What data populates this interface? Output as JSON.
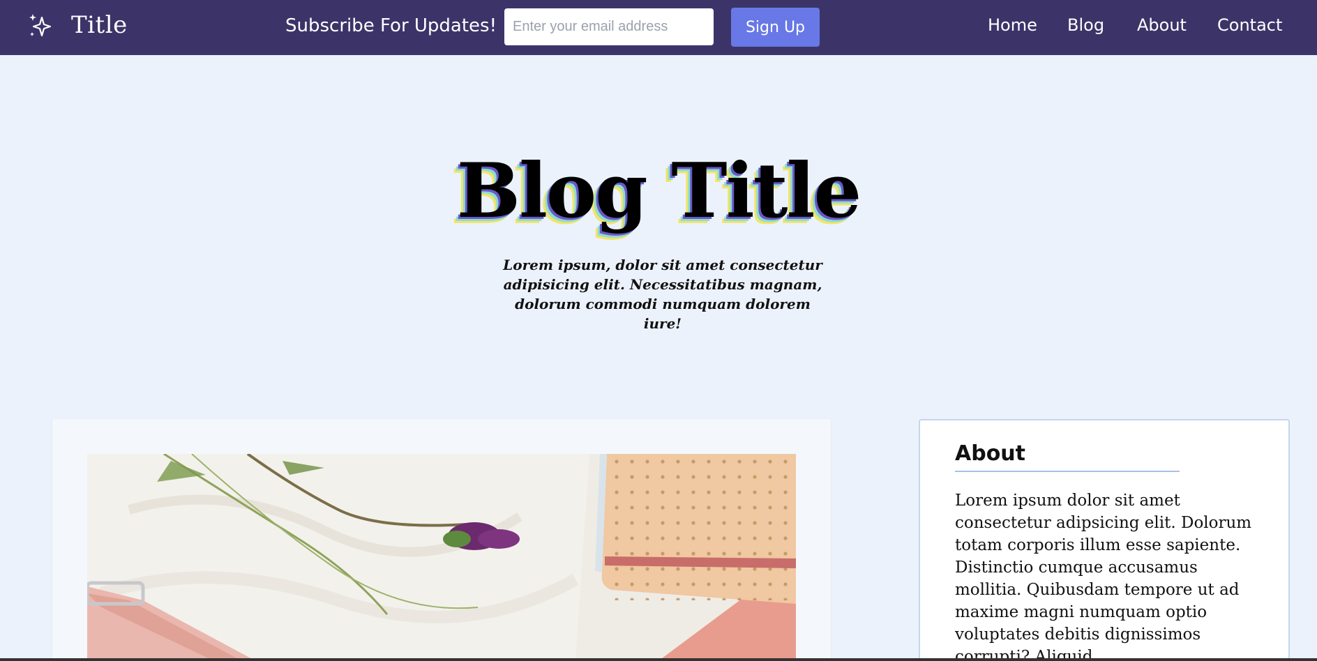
{
  "nav": {
    "logo_text": "Title",
    "subscribe_label": "Subscribe For Updates!",
    "email_placeholder": "Enter your email address",
    "signup_label": "Sign Up",
    "links": [
      {
        "label": "Home"
      },
      {
        "label": "Blog"
      },
      {
        "label": "About"
      },
      {
        "label": "Contact"
      }
    ]
  },
  "hero": {
    "title": "Blog Title",
    "subtitle": "Lorem ipsum, dolor sit amet consectetur adipisicing elit. Necessitatibus magnam, dolorum commodi numquam dolorem iure!"
  },
  "about": {
    "heading": "About",
    "body": "Lorem ipsum dolor sit amet consectetur adipsicing elit. Dolorum totam corporis illum esse sapiente. Distinctio cumque accusamus mollitia. Quibusdam tempore ut ad maxime magni numquam optio voluptates debitis dignissimos corrupti? Aliquid"
  },
  "colors": {
    "nav_bg": "#3c3468",
    "signup_bg": "#6878e6",
    "page_bg": "#ecf2fc"
  },
  "icons": {
    "logo": "sparkles-icon"
  }
}
